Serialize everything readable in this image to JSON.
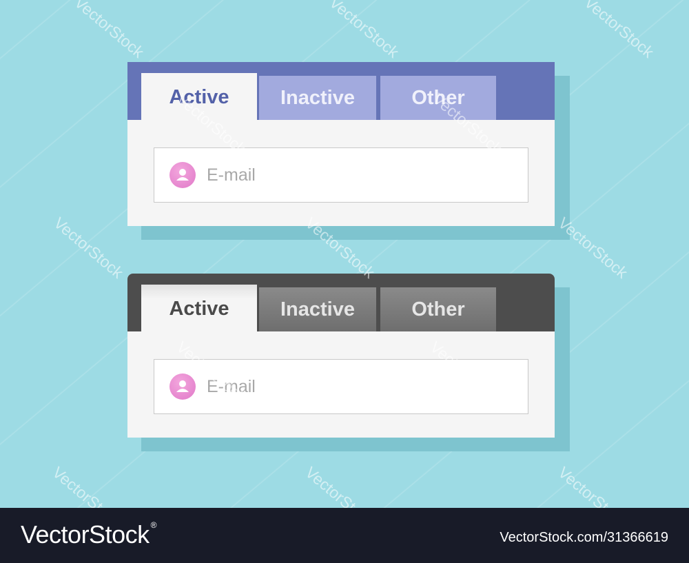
{
  "widgets": [
    {
      "theme": "blue",
      "tabs": [
        {
          "label": "Active",
          "state": "active"
        },
        {
          "label": "Inactive",
          "state": "inactive"
        },
        {
          "label": "Other",
          "state": "inactive"
        }
      ],
      "email_field": {
        "placeholder": "E-mail",
        "icon": "user-icon"
      }
    },
    {
      "theme": "dark",
      "tabs": [
        {
          "label": "Active",
          "state": "active"
        },
        {
          "label": "Inactive",
          "state": "inactive"
        },
        {
          "label": "Other",
          "state": "inactive"
        }
      ],
      "email_field": {
        "placeholder": "E-mail",
        "icon": "user-icon"
      }
    }
  ],
  "watermark": {
    "text": "VectorStock"
  },
  "footer": {
    "brand": "VectorStock",
    "registered_mark": "®",
    "image_id": "VectorStock.com/31366619"
  },
  "colors": {
    "background": "#9ddbe4",
    "blue_header": "#6574b7",
    "blue_tab_inactive": "#a2aade",
    "dark_header": "#4d4d4d",
    "dark_tab_inactive": "#7a7a7a",
    "avatar_pink": "#e58bd0",
    "footer_bg": "#181b28"
  }
}
